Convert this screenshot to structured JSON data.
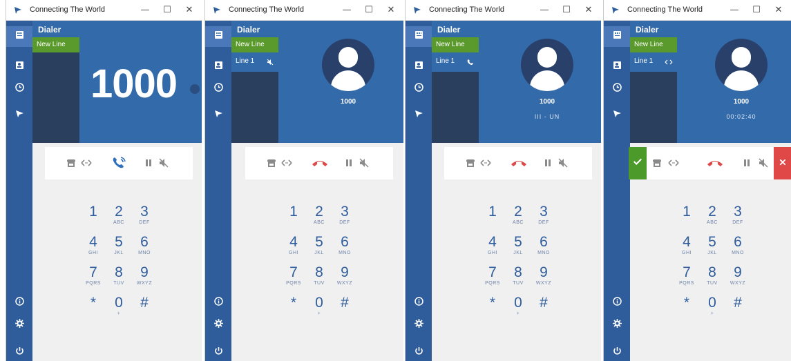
{
  "app": {
    "title": "Connecting The World",
    "colors": {
      "sidebar": "#2f5d9c",
      "header": "#336aaa",
      "accent_green": "#5a9a2c",
      "end_call_red": "#e04848",
      "digit_blue": "#2f5d9c"
    }
  },
  "window_controls": {
    "minimize": "—",
    "maximize": "☐",
    "close": "✕"
  },
  "sidebar_icons": [
    "dialer-icon",
    "contacts-icon",
    "history-icon",
    "brand-icon",
    "info-icon",
    "settings-icon",
    "power-icon"
  ],
  "dialer": {
    "label": "Dialer",
    "new_line": "New Line",
    "line_label": "Line 1"
  },
  "panels": [
    {
      "state": "dialing",
      "number": "1000"
    },
    {
      "state": "ringing",
      "caller": "1000",
      "status": ""
    },
    {
      "state": "connecting",
      "caller": "1000",
      "status": "III - UN"
    },
    {
      "state": "incoming",
      "caller": "1000",
      "status": "00:02:40"
    }
  ],
  "keypad": [
    {
      "digit": "1",
      "letters": ""
    },
    {
      "digit": "2",
      "letters": "ABC"
    },
    {
      "digit": "3",
      "letters": "DEF"
    },
    {
      "digit": "4",
      "letters": "GHI"
    },
    {
      "digit": "5",
      "letters": "JKL"
    },
    {
      "digit": "6",
      "letters": "MNO"
    },
    {
      "digit": "7",
      "letters": "PQRS"
    },
    {
      "digit": "8",
      "letters": "TUV"
    },
    {
      "digit": "9",
      "letters": "WXYZ"
    },
    {
      "digit": "*",
      "letters": ""
    },
    {
      "digit": "0",
      "letters": "+"
    },
    {
      "digit": "#",
      "letters": ""
    }
  ]
}
